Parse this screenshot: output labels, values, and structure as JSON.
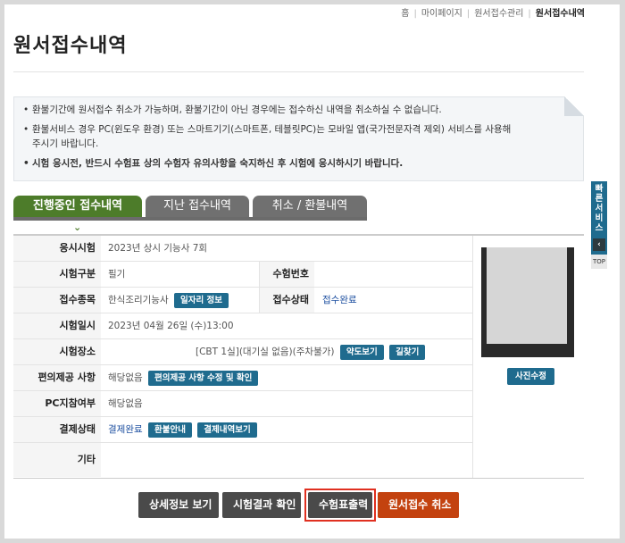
{
  "breadcrumb": [
    "홈",
    "마이페이지",
    "원서접수관리",
    "원서접수내역"
  ],
  "page_title": "원서접수내역",
  "notices": [
    {
      "text": "환불기간에 원서접수 취소가 가능하며, 환불기간이 아닌 경우에는 접수하신 내역을 취소하실 수 없습니다.",
      "bold": false
    },
    {
      "text": "환불서비스 경우 PC(윈도우 환경) 또는 스마트기기(스마트폰, 테블릿PC)는 모바일 앱(국가전문자격 제외) 서비스를 사용해 주시기 바랍니다.",
      "bold": false
    },
    {
      "text": "시험 응시전, 반드시 수험표 상의 수험자 유의사항을 숙지하신 후 시험에 응시하시기 바랍니다.",
      "bold": true
    }
  ],
  "tabs": [
    "진행중인 접수내역",
    "지난 접수내역",
    "취소 / 환불내역"
  ],
  "active_tab": 0,
  "info": {
    "exam_label": "응시시험",
    "exam_value": "2023년 상시 기능사 7회",
    "category_label": "시험구분",
    "category_value": "필기",
    "ticket_label": "수험번호",
    "ticket_value": "",
    "item_label": "접수종목",
    "item_value": "한식조리기능사",
    "job_info_button": "일자리 정보",
    "status_label": "접수상태",
    "status_value": "접수완료",
    "date_label": "시험일시",
    "date_value": "2023년 04월 26일 (수)13:00",
    "place_label": "시험장소",
    "place_value": "[CBT 1실](대기실 없음)(주차불가)",
    "map_button": "약도보기",
    "directions_button": "길찾기",
    "convenience_label": "편의제공 사항",
    "convenience_value": "해당없음",
    "convenience_button": "편의제공 사항 수정 및 확인",
    "pc_label": "PC지참여부",
    "pc_value": "해당없음",
    "payment_label": "결제상태",
    "payment_value": "결제완료",
    "refund_button": "환불안내",
    "payment_history_button": "결제내역보기",
    "etc_label": "기타",
    "etc_value": ""
  },
  "photo_button": "사진수정",
  "footer_buttons": {
    "detail": "상세정보 보기",
    "result": "시험결과 확인",
    "print": "수험표출력",
    "cancel": "원서접수 취소"
  },
  "quick_menu": {
    "label": "빠른서비스",
    "top": "TOP"
  },
  "colors": {
    "tab_active": "#4d7c2a",
    "tab_inactive": "#707070",
    "action_blue": "#1f6b8e",
    "cancel_orange": "#c3420f",
    "highlight_red": "#e03020",
    "link_blue": "#1d4fa0"
  }
}
